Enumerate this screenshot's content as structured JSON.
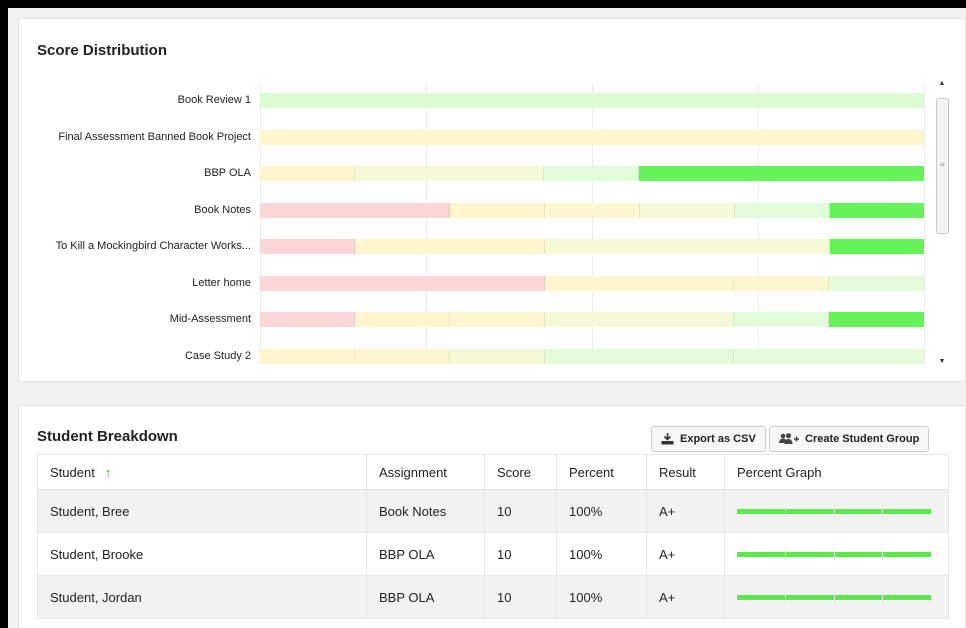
{
  "distribution": {
    "title": "Score Distribution",
    "colors": {
      "lightest_green": "#d9fdd3",
      "light_yellow": "#fff6cc",
      "yellow_green": "#f4fbd9",
      "pale_green": "#e4fbdc",
      "bright_green": "#66f35a",
      "pink": "#fdd6d6"
    },
    "rows": [
      {
        "label": "Book Review 1",
        "segments": [
          {
            "width": 1.0,
            "color": "#dcfcd4"
          }
        ]
      },
      {
        "label": "Final Assessment Banned Book Project",
        "segments": [
          {
            "width": 1.0,
            "color": "#fff6cd"
          }
        ]
      },
      {
        "label": "BBP OLA",
        "segments": [
          {
            "width": 0.143,
            "color": "#fff6cd"
          },
          {
            "width": 0.285,
            "color": "#f6f9d6"
          },
          {
            "width": 0.143,
            "color": "#e2fbd8"
          },
          {
            "width": 0.429,
            "color": "#66f35a"
          }
        ]
      },
      {
        "label": "Book Notes",
        "segments": [
          {
            "width": 0.286,
            "color": "#fdd7d7"
          },
          {
            "width": 0.143,
            "color": "#fff6cd"
          },
          {
            "width": 0.143,
            "color": "#fdf7cf"
          },
          {
            "width": 0.143,
            "color": "#f6f9d6"
          },
          {
            "width": 0.143,
            "color": "#e2fbd8"
          },
          {
            "width": 0.142,
            "color": "#66f35a"
          }
        ]
      },
      {
        "label": "To Kill a Mockingbird Character Works...",
        "segments": [
          {
            "width": 0.143,
            "color": "#fdd7d7"
          },
          {
            "width": 0.286,
            "color": "#fff6cd"
          },
          {
            "width": 0.429,
            "color": "#f6f9d6"
          },
          {
            "width": 0.142,
            "color": "#66f35a"
          }
        ]
      },
      {
        "label": "Letter home",
        "segments": [
          {
            "width": 0.429,
            "color": "#fdd7d7"
          },
          {
            "width": 0.285,
            "color": "#fff6cd"
          },
          {
            "width": 0.143,
            "color": "#fdf7cf"
          },
          {
            "width": 0.143,
            "color": "#e2fbd8"
          }
        ]
      },
      {
        "label": "Mid-Assessment",
        "segments": [
          {
            "width": 0.143,
            "color": "#fdd7d7"
          },
          {
            "width": 0.143,
            "color": "#fff6cd"
          },
          {
            "width": 0.143,
            "color": "#fdf7cf"
          },
          {
            "width": 0.285,
            "color": "#f6f9d6"
          },
          {
            "width": 0.143,
            "color": "#e2fbd8"
          },
          {
            "width": 0.143,
            "color": "#66f35a"
          }
        ]
      },
      {
        "label": "Case Study 2",
        "segments": [
          {
            "width": 0.143,
            "color": "#fff6cd"
          },
          {
            "width": 0.143,
            "color": "#fdf7cf"
          },
          {
            "width": 0.143,
            "color": "#f6f9d6"
          },
          {
            "width": 0.285,
            "color": "#e2fbd8"
          },
          {
            "width": 0.286,
            "color": "#e2fbd8"
          }
        ]
      }
    ]
  },
  "breakdown": {
    "title": "Student Breakdown",
    "export_label": "Export as CSV",
    "group_label": "Create Student Group",
    "columns": {
      "student": "Student",
      "assignment": "Assignment",
      "score": "Score",
      "percent": "Percent",
      "result": "Result",
      "graph": "Percent Graph"
    },
    "sort_indicator": "↑",
    "rows": [
      {
        "student": "Student, Bree",
        "assignment": "Book Notes",
        "score": "10",
        "percent": "100%",
        "result": "A+",
        "fill": 1.0
      },
      {
        "student": "Student, Brooke",
        "assignment": "BBP OLA",
        "score": "10",
        "percent": "100%",
        "result": "A+",
        "fill": 1.0
      },
      {
        "student": "Student, Jordan",
        "assignment": "BBP OLA",
        "score": "10",
        "percent": "100%",
        "result": "A+",
        "fill": 1.0
      }
    ]
  }
}
